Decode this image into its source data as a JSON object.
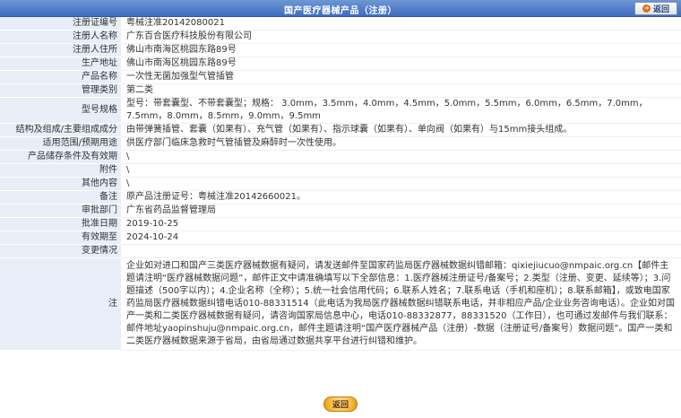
{
  "header": {
    "title": "国产医疗器械产品（注册）",
    "back_label": "返回"
  },
  "rows": [
    {
      "label": "注册证编号",
      "value": "粤械注准20142080021"
    },
    {
      "label": "注册人名称",
      "value": "广东百合医疗科技股份有限公司"
    },
    {
      "label": "注册人住所",
      "value": "佛山市南海区桃园东路89号"
    },
    {
      "label": "生产地址",
      "value": "佛山市南海区桃园东路89号"
    },
    {
      "label": "产品名称",
      "value": "一次性无菌加强型气管插管"
    },
    {
      "label": "管理类别",
      "value": "第二类"
    },
    {
      "label": "型号规格",
      "value": "型号：带套囊型、不带套囊型；规格： 3.0mm，3.5mm，4.0mm，4.5mm，5.0mm，5.5mm，6.0mm，6.5mm，7.0mm，7.5mm，8.0mm，8.5mm，9.0mm，9.5mm"
    },
    {
      "label": "结构及组成/主要组成成分",
      "value": "由带弹簧插管、套囊（如果有）、充气管（如果有）、指示球囊（如果有）、单向阀（如果有）与15mm接头组成。"
    },
    {
      "label": "适用范围/预期用途",
      "value": "供医疗部门临床急救时气管插管及麻醉时一次性使用。"
    },
    {
      "label": "产品储存条件及有效期",
      "value": "\\"
    },
    {
      "label": "附件",
      "value": "\\"
    },
    {
      "label": "其他内容",
      "value": "\\"
    },
    {
      "label": "备注",
      "value": "原产品注册证号：粤械注准20142660021。"
    },
    {
      "label": "审批部门",
      "value": "广东省药品监督管理局"
    },
    {
      "label": "批准日期",
      "value": "2019-10-25"
    },
    {
      "label": "有效期至",
      "value": "2024-10-24"
    },
    {
      "label": "变更情况",
      "value": ""
    }
  ],
  "note": {
    "label": "注",
    "text": "企业如对进口和国产三类医疗器械数据有疑问，请发送邮件至国家药监局医疗器械数据纠错邮箱：qixiejiucuo@nmpaic.org.cn【邮件主题请注明“医疗器械数据问题”，邮件正文中请准确填写以下全部信息：1.医疗器械注册证号/备案号；2.类型（注册、变更、延续等）；3.问题描述（500字以内）；4.企业名称（全称）；5.统一社会信用代码；6.联系人姓名；7.联系电话（手机和座机）；8.联系邮箱】，或致电国家药监局医疗器械数据纠错电话010-88331514（此电话为我局医疗器械数据纠错联系电话，并非相应产品/企业业务咨询电话）。企业如对国产一类和二类医疗器械数据有疑问，请咨询国家局信息中心，电话010-88332877，88331520（工作日），也可通过发邮件与我们联系：邮件地址yaopinshuju@nmpaic.org.cn，邮件主题请注明“国产医疗器械产品（注册）-数据（注册证号/备案号）数据问题”。国产一类和二类医疗器械数据来源于省局，由省局通过数据共享平台进行纠错和维护。"
  },
  "footer": {
    "back_label": "返回"
  },
  "colors": {
    "header_blue": "#3e6cc0",
    "label_bg": "#e7eef7",
    "back_button_orange": "#f4b233"
  }
}
